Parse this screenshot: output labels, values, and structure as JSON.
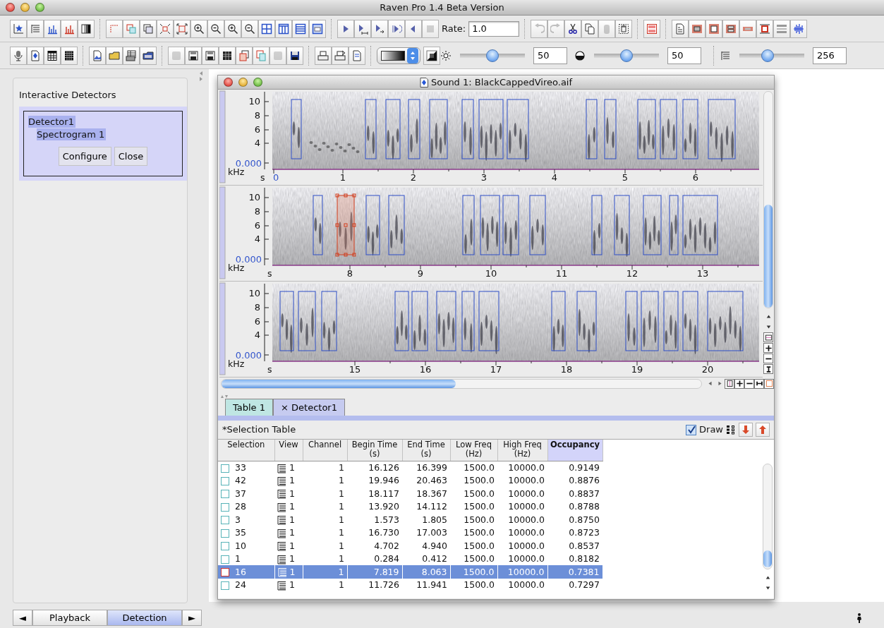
{
  "window": {
    "title": "Raven Pro 1.4 Beta Version"
  },
  "toolbar_1": [
    {
      "items": [
        {
          "kind": "button",
          "disabled": false
        },
        {
          "kind": "button",
          "disabled": false
        },
        {
          "kind": "button",
          "disabled": false
        },
        {
          "kind": "button",
          "disabled": false
        },
        {
          "kind": "button",
          "disabled": false
        }
      ]
    },
    {
      "items": [
        {
          "kind": "button",
          "disabled": false
        },
        {
          "kind": "button",
          "disabled": false
        },
        {
          "kind": "button",
          "disabled": false
        },
        {
          "kind": "button",
          "disabled": false
        },
        {
          "kind": "button",
          "disabled": false
        },
        {
          "kind": "button",
          "disabled": false
        },
        {
          "kind": "button",
          "disabled": false
        },
        {
          "kind": "button",
          "disabled": false
        },
        {
          "kind": "button",
          "disabled": false
        },
        {
          "kind": "button",
          "disabled": false
        },
        {
          "kind": "button",
          "disabled": false
        },
        {
          "kind": "button",
          "disabled": false
        },
        {
          "kind": "button",
          "disabled": false
        }
      ]
    },
    {
      "items": [
        {
          "kind": "button",
          "disabled": false
        },
        {
          "kind": "button",
          "disabled": false
        },
        {
          "kind": "button",
          "disabled": false
        },
        {
          "kind": "button",
          "disabled": false
        },
        {
          "kind": "button",
          "disabled": false
        },
        {
          "kind": "button",
          "disabled": true
        },
        {
          "kind": "field",
          "label": "Rate:",
          "value": "1.0"
        }
      ]
    },
    {
      "items": [
        {
          "kind": "button",
          "disabled": true
        },
        {
          "kind": "button",
          "disabled": true
        },
        {
          "kind": "button",
          "disabled": false
        },
        {
          "kind": "button",
          "disabled": false
        },
        {
          "kind": "button",
          "disabled": true
        },
        {
          "kind": "button",
          "disabled": false
        }
      ]
    },
    {
      "items": [
        {
          "kind": "button",
          "disabled": false
        }
      ]
    },
    {
      "items": [
        {
          "kind": "button",
          "disabled": false
        },
        {
          "kind": "button",
          "disabled": false
        },
        {
          "kind": "button",
          "disabled": false
        },
        {
          "kind": "button",
          "disabled": false
        },
        {
          "kind": "button",
          "disabled": false
        },
        {
          "kind": "button",
          "disabled": false
        },
        {
          "kind": "button",
          "disabled": false
        },
        {
          "kind": "button",
          "disabled": false
        }
      ]
    }
  ],
  "toolbar_2": [
    {
      "items": [
        {
          "kind": "button",
          "disabled": false
        },
        {
          "kind": "button",
          "disabled": false
        },
        {
          "kind": "button",
          "disabled": false
        },
        {
          "kind": "button",
          "disabled": false
        }
      ]
    },
    {
      "items": [
        {
          "kind": "button",
          "disabled": false
        },
        {
          "kind": "button",
          "disabled": false
        },
        {
          "kind": "button",
          "disabled": false
        },
        {
          "kind": "button",
          "disabled": false
        }
      ]
    },
    {
      "items": [
        {
          "kind": "button",
          "disabled": true
        },
        {
          "kind": "button",
          "disabled": false
        },
        {
          "kind": "button",
          "disabled": false
        },
        {
          "kind": "button",
          "disabled": false
        },
        {
          "kind": "button",
          "disabled": false
        },
        {
          "kind": "button",
          "disabled": false
        },
        {
          "kind": "button",
          "disabled": true
        },
        {
          "kind": "button",
          "disabled": false
        }
      ]
    },
    {
      "items": [
        {
          "kind": "button",
          "disabled": false
        },
        {
          "kind": "button",
          "disabled": false
        },
        {
          "kind": "button",
          "disabled": false
        }
      ]
    },
    {
      "items": [
        {
          "kind": "combo"
        },
        {
          "kind": "button",
          "disabled": false
        },
        {
          "kind": "slider",
          "level": 0.5,
          "value": "50"
        },
        {
          "kind": "slider",
          "level": 0.5,
          "value": "50"
        }
      ]
    },
    {
      "items": [
        {
          "kind": "slider",
          "level": 0.43,
          "value": "256"
        }
      ]
    }
  ],
  "detectors_panel": {
    "title": "Interactive Detectors",
    "tree": [
      {
        "label": "Detector1",
        "selected": true,
        "children": [
          {
            "label": "Spectrogram 1",
            "selected": true
          }
        ]
      }
    ],
    "buttons": [
      "Configure",
      "Close"
    ]
  },
  "sound_window": {
    "title": "Sound 1: BlackCappedVireo.aif",
    "panels": [
      {
        "y_ticks": [
          "10",
          "8",
          "6",
          "4"
        ],
        "y_origin": "0.000",
        "y_unit": "kHz",
        "x_unit": "s",
        "x_origin": "0",
        "x_ticks": [
          "1",
          "2",
          "3",
          "4",
          "5",
          "6"
        ],
        "selections": [
          {
            "selected": false
          },
          {
            "selected": false
          },
          {
            "selected": false
          },
          {
            "selected": false
          },
          {
            "selected": false
          },
          {
            "selected": false
          },
          {
            "selected": false
          },
          {
            "selected": false
          },
          {
            "selected": false
          },
          {
            "selected": false
          },
          {
            "selected": false
          },
          {
            "selected": false
          },
          {
            "selected": false
          },
          {
            "selected": false
          }
        ]
      },
      {
        "y_ticks": [
          "10",
          "8",
          "6",
          "4"
        ],
        "y_origin": "0.000",
        "y_unit": "kHz",
        "x_unit": "s",
        "x_ticks": [
          "8",
          "9",
          "10",
          "11",
          "12",
          "13"
        ],
        "selections": [
          {
            "selected": false
          },
          {
            "selected": true
          },
          {
            "selected": false
          },
          {
            "selected": false
          },
          {
            "selected": false
          },
          {
            "selected": false
          },
          {
            "selected": false
          },
          {
            "selected": false
          },
          {
            "selected": false
          },
          {
            "selected": false
          },
          {
            "selected": false
          },
          {
            "selected": false
          },
          {
            "selected": false
          }
        ]
      },
      {
        "y_ticks": [
          "10",
          "8",
          "6",
          "4"
        ],
        "y_origin": "0.000",
        "y_unit": "kHz",
        "x_unit": "s",
        "x_ticks": [
          "15",
          "16",
          "17",
          "18",
          "19",
          "20"
        ],
        "selections": [
          {
            "selected": false
          },
          {
            "selected": false
          },
          {
            "selected": false
          },
          {
            "selected": false
          },
          {
            "selected": false
          },
          {
            "selected": false
          },
          {
            "selected": false
          },
          {
            "selected": false
          },
          {
            "selected": false
          },
          {
            "selected": false
          },
          {
            "selected": false
          },
          {
            "selected": false
          },
          {
            "selected": false
          },
          {
            "selected": false
          },
          {
            "selected": false
          }
        ]
      }
    ],
    "tabs": [
      {
        "label": "Table 1",
        "selected": false
      },
      {
        "label": "× Detector1",
        "selected": true
      }
    ],
    "table_title": "*Selection Table",
    "draw": {
      "label": "Draw",
      "checked": true
    },
    "columns": [
      {
        "label": "Selection",
        "sorted": false
      },
      {
        "label": "View",
        "sorted": false
      },
      {
        "label": "Channel",
        "sorted": false
      },
      {
        "label": "Begin Time",
        "unit": "(s)",
        "sorted": false
      },
      {
        "label": "End Time",
        "unit": "(s)",
        "sorted": false
      },
      {
        "label": "Low Freq",
        "unit": "(Hz)",
        "sorted": false
      },
      {
        "label": "High Freq",
        "unit": "(Hz)",
        "sorted": false
      },
      {
        "label": "Occupancy",
        "sorted": true
      }
    ],
    "rows": [
      {
        "selection": "33",
        "view": "1",
        "channel": "1",
        "begin": "16.126",
        "end": "16.399",
        "low": "1500.0",
        "high": "10000.0",
        "occupancy": "0.9149",
        "selected": false
      },
      {
        "selection": "42",
        "view": "1",
        "channel": "1",
        "begin": "19.946",
        "end": "20.463",
        "low": "1500.0",
        "high": "10000.0",
        "occupancy": "0.8876",
        "selected": false
      },
      {
        "selection": "37",
        "view": "1",
        "channel": "1",
        "begin": "18.117",
        "end": "18.367",
        "low": "1500.0",
        "high": "10000.0",
        "occupancy": "0.8837",
        "selected": false
      },
      {
        "selection": "28",
        "view": "1",
        "channel": "1",
        "begin": "13.920",
        "end": "14.112",
        "low": "1500.0",
        "high": "10000.0",
        "occupancy": "0.8788",
        "selected": false
      },
      {
        "selection": "3",
        "view": "1",
        "channel": "1",
        "begin": "1.573",
        "end": "1.805",
        "low": "1500.0",
        "high": "10000.0",
        "occupancy": "0.8750",
        "selected": false
      },
      {
        "selection": "35",
        "view": "1",
        "channel": "1",
        "begin": "16.730",
        "end": "17.003",
        "low": "1500.0",
        "high": "10000.0",
        "occupancy": "0.8723",
        "selected": false
      },
      {
        "selection": "10",
        "view": "1",
        "channel": "1",
        "begin": "4.702",
        "end": "4.940",
        "low": "1500.0",
        "high": "10000.0",
        "occupancy": "0.8537",
        "selected": false
      },
      {
        "selection": "1",
        "view": "1",
        "channel": "1",
        "begin": "0.284",
        "end": "0.412",
        "low": "1500.0",
        "high": "10000.0",
        "occupancy": "0.8182",
        "selected": false
      },
      {
        "selection": "16",
        "view": "1",
        "channel": "1",
        "begin": "7.819",
        "end": "8.063",
        "low": "1500.0",
        "high": "10000.0",
        "occupancy": "0.7381",
        "selected": true
      },
      {
        "selection": "24",
        "view": "1",
        "channel": "1",
        "begin": "11.726",
        "end": "11.941",
        "low": "1500.0",
        "high": "10000.0",
        "occupancy": "0.7297",
        "selected": false
      }
    ]
  },
  "bottom_tabs": {
    "prev": "◄",
    "tabs": [
      {
        "label": "Playback",
        "selected": false
      },
      {
        "label": "Detection",
        "selected": true
      }
    ],
    "next": "►"
  }
}
